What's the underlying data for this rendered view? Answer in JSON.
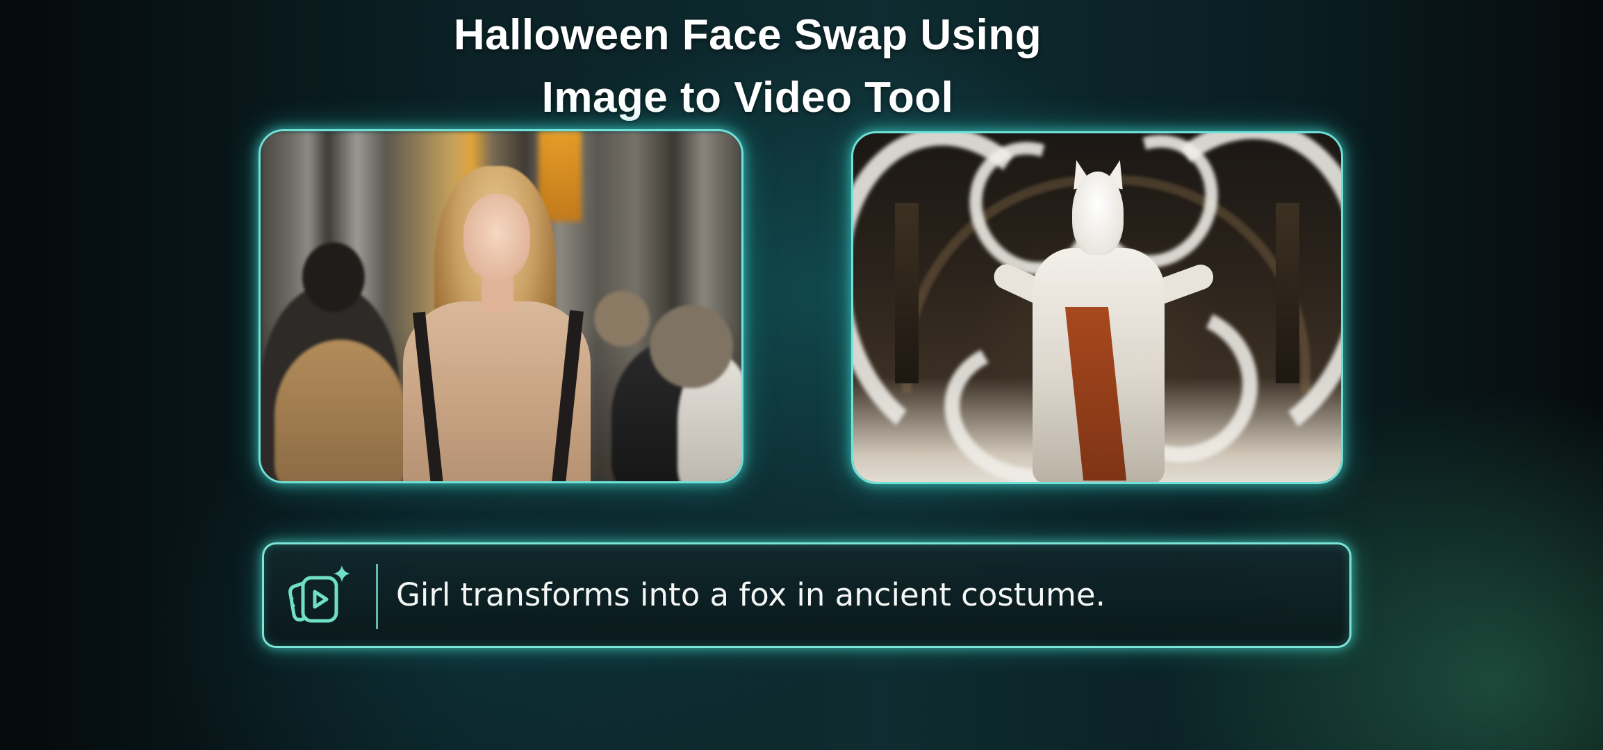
{
  "title": {
    "line_1": "Halloween Face Swap Using",
    "line_2": "Image to Video Tool"
  },
  "images": {
    "source": {
      "description_icon": "photo-woman-street"
    },
    "result": {
      "description_icon": "photo-fox-ancient-costume"
    }
  },
  "prompt": {
    "icon": "image-to-video-sparkle-icon",
    "text": "Girl transforms into a fox in ancient costume."
  },
  "colors": {
    "accent_glow": "#7ff0e1",
    "background_dark": "#0b2226",
    "text": "#ffffff"
  }
}
